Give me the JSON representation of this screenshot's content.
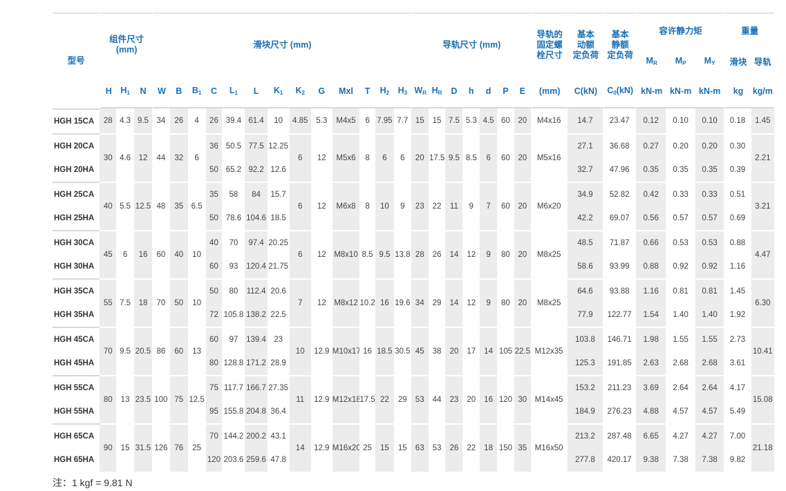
{
  "header": {
    "model": "型号",
    "assembly": "组件尺寸\n(mm)",
    "block": "滑块尺寸 (mm)",
    "rail": "导轨尺寸 (mm)",
    "rail_bolt": "导轨的\n固定螺\n栓尺寸",
    "dyn_load": "基本\n动额\n定负荷",
    "static_load": "基本\n静额\n定负荷",
    "moment": "容许静力矩",
    "weight": "重量",
    "mr": "M",
    "mr_sub": "R",
    "mp": "M",
    "mp_sub": "P",
    "my": "M",
    "my_sub": "Y",
    "block_w": "滑块",
    "rail_w": "导轨",
    "cols": [
      {
        "t": "H",
        "s": ""
      },
      {
        "t": "H",
        "s": "1"
      },
      {
        "t": "N",
        "s": ""
      },
      {
        "t": "W",
        "s": ""
      },
      {
        "t": "B",
        "s": ""
      },
      {
        "t": "B",
        "s": "1"
      },
      {
        "t": "C",
        "s": ""
      },
      {
        "t": "L",
        "s": "1"
      },
      {
        "t": "L",
        "s": ""
      },
      {
        "t": "K",
        "s": "1"
      },
      {
        "t": "K",
        "s": "2"
      },
      {
        "t": "G",
        "s": ""
      },
      {
        "t": "Mxl",
        "s": ""
      },
      {
        "t": "T",
        "s": ""
      },
      {
        "t": "H",
        "s": "2"
      },
      {
        "t": "H",
        "s": "3"
      },
      {
        "t": "W",
        "s": "R"
      },
      {
        "t": "H",
        "s": "R"
      },
      {
        "t": "D",
        "s": ""
      },
      {
        "t": "h",
        "s": ""
      },
      {
        "t": "d",
        "s": ""
      },
      {
        "t": "P",
        "s": ""
      },
      {
        "t": "E",
        "s": ""
      }
    ],
    "mm": "(mm)",
    "c_kn": "C(kN)",
    "c0": "C",
    "c0_sub": "0",
    "c0_unit": "(kN)",
    "knm1": "kN-m",
    "knm2": "kN-m",
    "knm3": "kN-m",
    "kg": "kg",
    "kgm": "kg/m"
  },
  "groups": [
    {
      "rows": [
        {
          "model": "HGH 15CA",
          "H": "28",
          "H1": "4.3",
          "N": "9.5",
          "W": "34",
          "B": "26",
          "B1": "4",
          "C": "26",
          "L1": "39.4",
          "L": "61.4",
          "K1": "10",
          "K2": "4.85",
          "G": "5.3",
          "Mxl": "M4x5",
          "T": "6",
          "H2": "7.95",
          "H3": "7.7",
          "WR": "15",
          "HR": "15",
          "D": "7.5",
          "h": "5.3",
          "d": "4.5",
          "P": "60",
          "E": "20",
          "bolt": "M4x16",
          "C_kN": "14.7",
          "C0": "23.47",
          "MR": "0.12",
          "MP": "0.10",
          "MY": "0.10",
          "kg": "0.18",
          "kgm": "1.45"
        }
      ]
    },
    {
      "rows": [
        {
          "model": "HGH 20CA",
          "H": "30",
          "H1": "4.6",
          "N": "12",
          "W": "44",
          "B": "32",
          "B1": "6",
          "C": "36",
          "L1": "50.5",
          "L": "77.5",
          "K1": "12.25",
          "K2": "6",
          "G": "12",
          "Mxl": "M5x6",
          "T": "8",
          "H2": "6",
          "H3": "6",
          "WR": "20",
          "HR": "17.5",
          "D": "9.5",
          "h": "8.5",
          "d": "6",
          "P": "60",
          "E": "20",
          "bolt": "M5x16",
          "C_kN": "27.1",
          "C0": "36.68",
          "MR": "0.27",
          "MP": "0.20",
          "MY": "0.20",
          "kg": "0.30",
          "kgm": "2.21"
        },
        {
          "model": "HGH 20HA",
          "C": "50",
          "L1": "65.2",
          "L": "92.2",
          "K1": "12.6",
          "C_kN": "32.7",
          "C0": "47.96",
          "MR": "0.35",
          "MP": "0.35",
          "MY": "0.35",
          "kg": "0.39"
        }
      ]
    },
    {
      "rows": [
        {
          "model": "HGH 25CA",
          "H": "40",
          "H1": "5.5",
          "N": "12.5",
          "W": "48",
          "B": "35",
          "B1": "6.5",
          "C": "35",
          "L1": "58",
          "L": "84",
          "K1": "15.7",
          "K2": "6",
          "G": "12",
          "Mxl": "M6x8",
          "T": "8",
          "H2": "10",
          "H3": "9",
          "WR": "23",
          "HR": "22",
          "D": "11",
          "h": "9",
          "d": "7",
          "P": "60",
          "E": "20",
          "bolt": "M6x20",
          "C_kN": "34.9",
          "C0": "52.82",
          "MR": "0.42",
          "MP": "0.33",
          "MY": "0.33",
          "kg": "0.51",
          "kgm": "3.21"
        },
        {
          "model": "HGH 25HA",
          "C": "50",
          "L1": "78.6",
          "L": "104.6",
          "K1": "18.5",
          "C_kN": "42.2",
          "C0": "69.07",
          "MR": "0.56",
          "MP": "0.57",
          "MY": "0.57",
          "kg": "0.69"
        }
      ]
    },
    {
      "rows": [
        {
          "model": "HGH 30CA",
          "H": "45",
          "H1": "6",
          "N": "16",
          "W": "60",
          "B": "40",
          "B1": "10",
          "C": "40",
          "L1": "70",
          "L": "97.4",
          "K1": "20.25",
          "K2": "6",
          "G": "12",
          "Mxl": "M8x10",
          "T": "8.5",
          "H2": "9.5",
          "H3": "13.8",
          "WR": "28",
          "HR": "26",
          "D": "14",
          "h": "12",
          "d": "9",
          "P": "80",
          "E": "20",
          "bolt": "M8x25",
          "C_kN": "48.5",
          "C0": "71.87",
          "MR": "0.66",
          "MP": "0.53",
          "MY": "0.53",
          "kg": "0.88",
          "kgm": "4.47"
        },
        {
          "model": "HGH 30HA",
          "C": "60",
          "L1": "93",
          "L": "120.4",
          "K1": "21.75",
          "C_kN": "58.6",
          "C0": "93.99",
          "MR": "0.88",
          "MP": "0.92",
          "MY": "0.92",
          "kg": "1.16"
        }
      ]
    },
    {
      "rows": [
        {
          "model": "HGH 35CA",
          "H": "55",
          "H1": "7.5",
          "N": "18",
          "W": "70",
          "B": "50",
          "B1": "10",
          "C": "50",
          "L1": "80",
          "L": "112.4",
          "K1": "20.6",
          "K2": "7",
          "G": "12",
          "Mxl": "M8x12",
          "T": "10.2",
          "H2": "16",
          "H3": "19.6",
          "WR": "34",
          "HR": "29",
          "D": "14",
          "h": "12",
          "d": "9",
          "P": "80",
          "E": "20",
          "bolt": "M8x25",
          "C_kN": "64.6",
          "C0": "93.88",
          "MR": "1.16",
          "MP": "0.81",
          "MY": "0.81",
          "kg": "1.45",
          "kgm": "6.30"
        },
        {
          "model": "HGH 35HA",
          "C": "72",
          "L1": "105.8",
          "L": "138.2",
          "K1": "22.5",
          "C_kN": "77.9",
          "C0": "122.77",
          "MR": "1.54",
          "MP": "1.40",
          "MY": "1.40",
          "kg": "1.92"
        }
      ]
    },
    {
      "rows": [
        {
          "model": "HGH 45CA",
          "H": "70",
          "H1": "9.5",
          "N": "20.5",
          "W": "86",
          "B": "60",
          "B1": "13",
          "C": "60",
          "L1": "97",
          "L": "139.4",
          "K1": "23",
          "K2": "10",
          "G": "12.9",
          "Mxl": "M10x17",
          "T": "16",
          "H2": "18.5",
          "H3": "30.5",
          "WR": "45",
          "HR": "38",
          "D": "20",
          "h": "17",
          "d": "14",
          "P": "105",
          "E": "22.5",
          "bolt": "M12x35",
          "C_kN": "103.8",
          "C0": "146.71",
          "MR": "1.98",
          "MP": "1.55",
          "MY": "1.55",
          "kg": "2.73",
          "kgm": "10.41"
        },
        {
          "model": "HGH 45HA",
          "C": "80",
          "L1": "128.8",
          "L": "171.2",
          "K1": "28.9",
          "C_kN": "125.3",
          "C0": "191.85",
          "MR": "2.63",
          "MP": "2.68",
          "MY": "2.68",
          "kg": "3.61"
        }
      ]
    },
    {
      "rows": [
        {
          "model": "HGH 55CA",
          "H": "80",
          "H1": "13",
          "N": "23.5",
          "W": "100",
          "B": "75",
          "B1": "12.5",
          "C": "75",
          "L1": "117.7",
          "L": "166.7",
          "K1": "27.35",
          "K2": "11",
          "G": "12.9",
          "Mxl": "M12x18",
          "T": "17.5",
          "H2": "22",
          "H3": "29",
          "WR": "53",
          "HR": "44",
          "D": "23",
          "h": "20",
          "d": "16",
          "P": "120",
          "E": "30",
          "bolt": "M14x45",
          "C_kN": "153.2",
          "C0": "211.23",
          "MR": "3.69",
          "MP": "2.64",
          "MY": "2.64",
          "kg": "4.17",
          "kgm": "15.08"
        },
        {
          "model": "HGH 55HA",
          "C": "95",
          "L1": "155.8",
          "L": "204.8",
          "K1": "36.4",
          "C_kN": "184.9",
          "C0": "276.23",
          "MR": "4.88",
          "MP": "4.57",
          "MY": "4.57",
          "kg": "5.49"
        }
      ]
    },
    {
      "rows": [
        {
          "model": "HGH 65CA",
          "H": "90",
          "H1": "15",
          "N": "31.5",
          "W": "126",
          "B": "76",
          "B1": "25",
          "C": "70",
          "L1": "144.2",
          "L": "200.2",
          "K1": "43.1",
          "K2": "14",
          "G": "12.9",
          "Mxl": "M16x20",
          "T": "25",
          "H2": "15",
          "H3": "15",
          "WR": "63",
          "HR": "53",
          "D": "26",
          "h": "22",
          "d": "18",
          "P": "150",
          "E": "35",
          "bolt": "M16x50",
          "C_kN": "213.2",
          "C0": "287.48",
          "MR": "6.65",
          "MP": "4.27",
          "MY": "4.27",
          "kg": "7.00",
          "kgm": "21.18"
        },
        {
          "model": "HGH 65HA",
          "C": "120",
          "L1": "203.6",
          "L": "259.6",
          "K1": "47.8",
          "C_kN": "277.8",
          "C0": "420.17",
          "MR": "9.38",
          "MP": "7.38",
          "MY": "7.38",
          "kg": "9.82"
        }
      ]
    }
  ],
  "note": "注：1 kgf = 9.81 N"
}
